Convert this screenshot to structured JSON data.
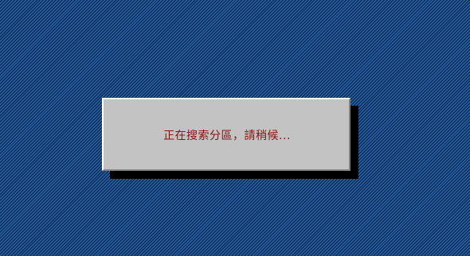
{
  "screen": {
    "background_color": "#1f5694"
  },
  "dialog": {
    "message": "正在搜索分區，請稍候...",
    "background_color": "#c3c3c3",
    "text_color": "#8c1010"
  }
}
